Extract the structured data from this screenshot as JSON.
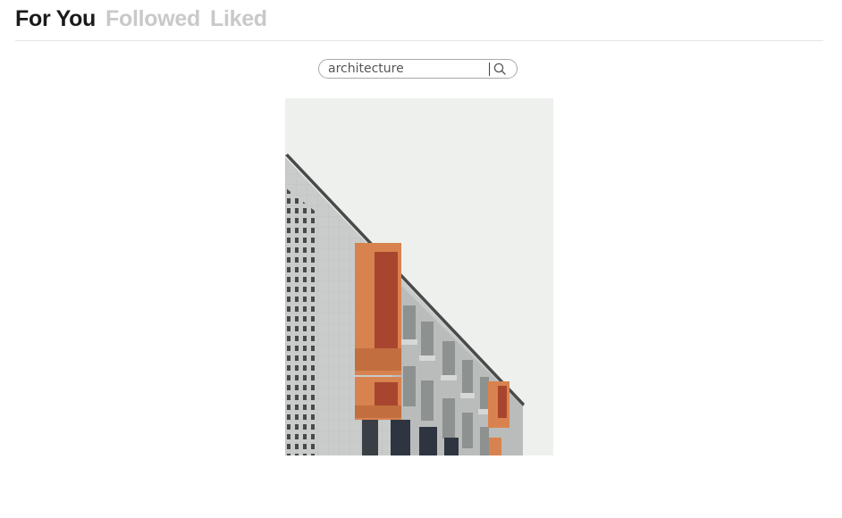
{
  "tabs": [
    {
      "label": "For You",
      "active": true
    },
    {
      "label": "Followed",
      "active": false
    },
    {
      "label": "Liked",
      "active": false
    }
  ],
  "search": {
    "value": "architecture",
    "icon": "search-icon"
  },
  "photo": {
    "subject": "architecture-photo",
    "colors": {
      "sky": "#eef0ee",
      "facade": "#c8cbc9",
      "balcony": "#d8834f"
    }
  }
}
